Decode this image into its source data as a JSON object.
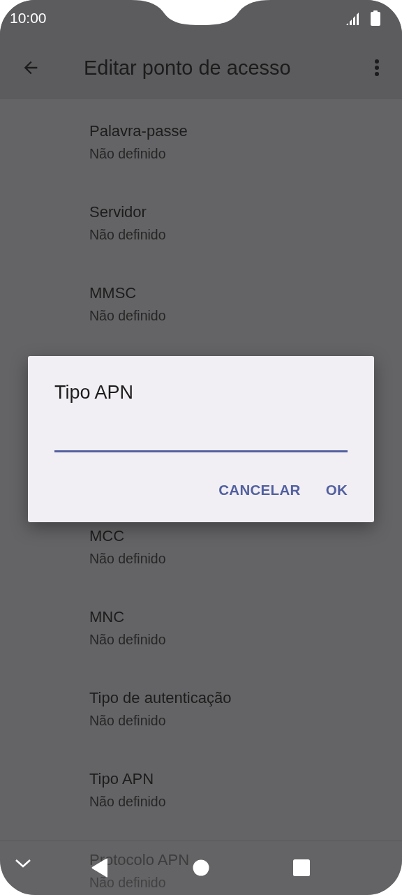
{
  "status_bar": {
    "time": "10:00"
  },
  "app_bar": {
    "title": "Editar ponto de acesso"
  },
  "settings_above": [
    {
      "title": "Palavra-passe",
      "value": "Não definido"
    },
    {
      "title": "Servidor",
      "value": "Não definido"
    },
    {
      "title": "MMSC",
      "value": "Não definido"
    }
  ],
  "dialog": {
    "title": "Tipo APN",
    "buttons": [
      "CANCELAR",
      "OK"
    ]
  },
  "settings_below": [
    {
      "title": "MCC",
      "value": "Não definido"
    },
    {
      "title": "MNC",
      "value": "Não definido"
    },
    {
      "title": "Tipo de autenticação",
      "value": "Não definido"
    },
    {
      "title": "Tipo APN",
      "value": "Não definido"
    },
    {
      "title": "Protocolo APN",
      "value": "Não definido"
    }
  ]
}
